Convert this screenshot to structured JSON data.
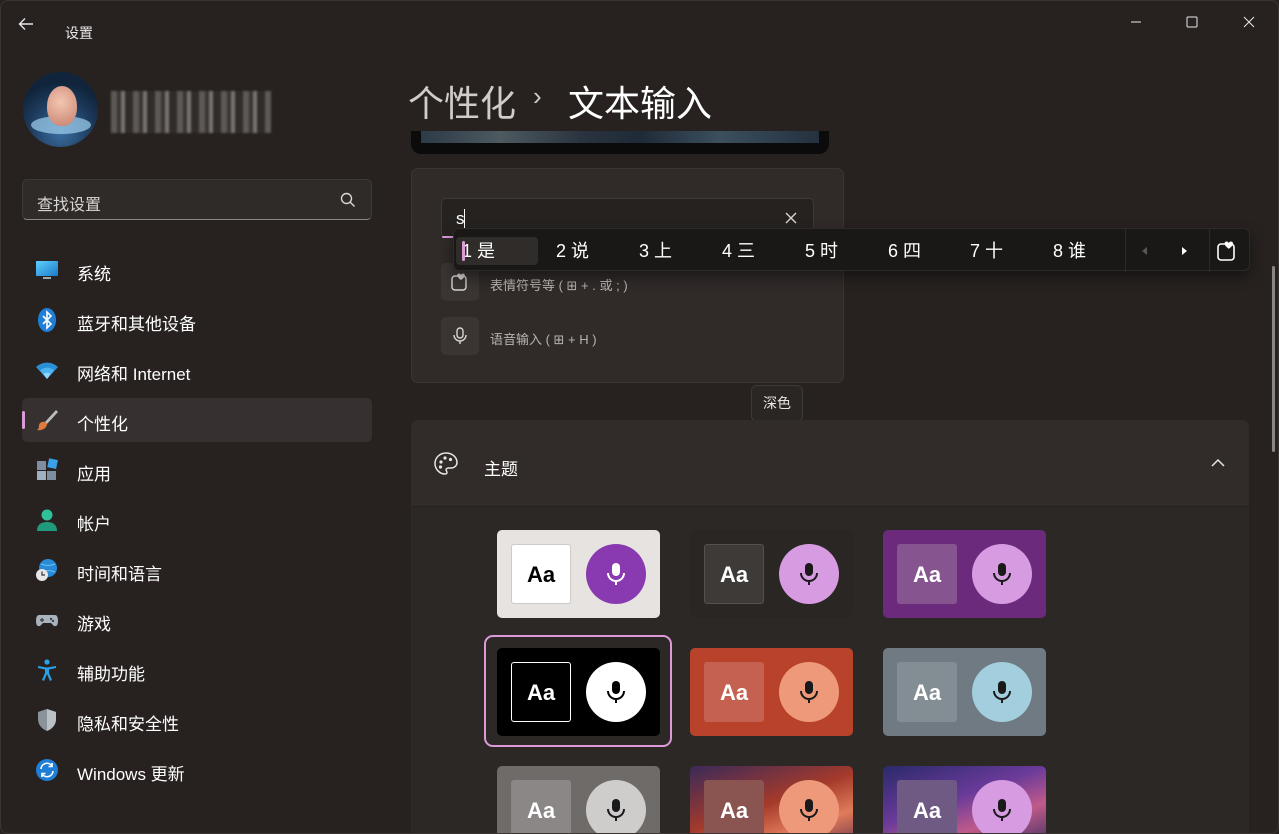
{
  "window": {
    "title": "设置"
  },
  "search": {
    "value": "查找设置"
  },
  "nav": {
    "items": [
      {
        "id": "system",
        "label": "系统",
        "icon": "system-icon"
      },
      {
        "id": "bluetooth",
        "label": "蓝牙和其他设备",
        "icon": "bluetooth-icon"
      },
      {
        "id": "network",
        "label": "网络和 Internet",
        "icon": "wifi-icon"
      },
      {
        "id": "personalization",
        "label": "个性化",
        "icon": "brush-icon"
      },
      {
        "id": "apps",
        "label": "应用",
        "icon": "apps-icon"
      },
      {
        "id": "accounts",
        "label": "帐户",
        "icon": "account-icon"
      },
      {
        "id": "time",
        "label": "时间和语言",
        "icon": "globe-clock-icon"
      },
      {
        "id": "gaming",
        "label": "游戏",
        "icon": "gamepad-icon"
      },
      {
        "id": "accessibility",
        "label": "辅助功能",
        "icon": "accessibility-icon"
      },
      {
        "id": "privacy",
        "label": "隐私和安全性",
        "icon": "shield-icon"
      },
      {
        "id": "update",
        "label": "Windows 更新",
        "icon": "update-icon"
      }
    ],
    "selected": "personalization"
  },
  "breadcrumb": {
    "parent": "个性化",
    "separator": "›",
    "current": "文本输入"
  },
  "ime": {
    "input_value": "s",
    "actions": [
      {
        "label": "表情符号等 ( ⊞ + . 或 ; )",
        "icon": "emoji-heart-icon"
      },
      {
        "label": "语音输入 ( ⊞ + H )",
        "icon": "microphone-icon"
      }
    ],
    "candidates": [
      "1 是",
      "2 说",
      "3 上",
      "4 三",
      "5 时",
      "6 四",
      "7 十",
      "8 谁"
    ]
  },
  "tooltip": "深色",
  "theme_section": {
    "label": "主题",
    "sample_text": "Aa",
    "cards": [
      {
        "bg": "#e6e3e1",
        "aa_bg": "#ffffff",
        "aa_fg": "#000000",
        "aa_border": "#cfcbc8",
        "mic_bg": "#8a3ab0",
        "mic_fg": "#ffffff"
      },
      {
        "bg": "#2a2624",
        "aa_bg": "#3d3a38",
        "aa_fg": "#ffffff",
        "aa_border": "#555150",
        "mic_bg": "#d79be2",
        "mic_fg": "#1a1a1a"
      },
      {
        "bg": "#6b2a7c",
        "aa_bg": "#86548f",
        "aa_fg": "#ffffff",
        "aa_border": "#86548f",
        "mic_bg": "#d79be2",
        "mic_fg": "#1a1a1a"
      },
      {
        "bg": "#000000",
        "aa_bg": "#000000",
        "aa_fg": "#ffffff",
        "aa_border": "#ffffff",
        "mic_bg": "#ffffff",
        "mic_fg": "#000000"
      },
      {
        "bg": "#b8432a",
        "aa_bg": "#c46150",
        "aa_fg": "#ffffff",
        "aa_border": "#c46150",
        "mic_bg": "#ee9a7a",
        "mic_fg": "#1a1a1a"
      },
      {
        "bg": "#6f7a82",
        "aa_bg": "#838d94",
        "aa_fg": "#ffffff",
        "aa_border": "#838d94",
        "mic_bg": "#a2cede",
        "mic_fg": "#1a1a1a"
      },
      {
        "bg": "#6e6b69",
        "aa_bg": "#8a8786",
        "aa_fg": "#ffffff",
        "aa_border": "#8a8786",
        "mic_bg": "#cfcdcc",
        "mic_fg": "#1a1a1a"
      },
      {
        "bg": "linear-gradient(160deg,#3a2a5a 0%,#a53a2a 45%,#e07b5a 70%,#5a2a4a 100%)",
        "aa_bg": "#8a5450",
        "aa_fg": "#ffffff",
        "aa_border": "#8a5450",
        "mic_bg": "#ee9a7a",
        "mic_fg": "#1a1a1a"
      },
      {
        "bg": "linear-gradient(160deg,#2a2a6a 0%,#6a3a9a 40%,#c05a8a 65%,#2a2a5a 100%)",
        "aa_bg": "#6e5a82",
        "aa_fg": "#ffffff",
        "aa_border": "#6e5a82",
        "mic_bg": "#d79be2",
        "mic_fg": "#1a1a1a"
      }
    ],
    "selected_index": 3
  },
  "colors": {
    "accent": "#dc9ad8",
    "window_bg": "#272220",
    "card_bg": "#302b29"
  }
}
